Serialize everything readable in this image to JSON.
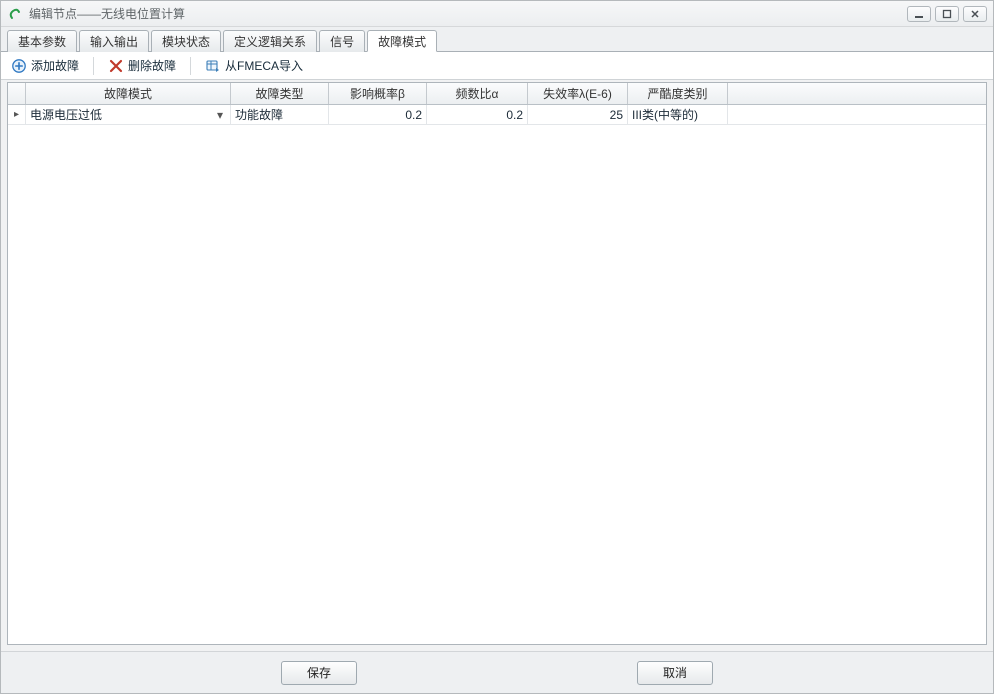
{
  "window": {
    "title": "编辑节点——无线电位置计算"
  },
  "tabs": [
    {
      "label": "基本参数",
      "active": false
    },
    {
      "label": "输入输出",
      "active": false
    },
    {
      "label": "模块状态",
      "active": false
    },
    {
      "label": "定义逻辑关系",
      "active": false
    },
    {
      "label": "信号",
      "active": false
    },
    {
      "label": "故障模式",
      "active": true
    }
  ],
  "toolbar": {
    "add_label": "添加故障",
    "delete_label": "删除故障",
    "import_label": "从FMECA导入"
  },
  "grid": {
    "headers": {
      "mode": "故障模式",
      "type": "故障类型",
      "beta": "影响概率β",
      "alpha": "频数比α",
      "lambda": "失效率λ(E-6)",
      "sev": "严酷度类别"
    },
    "rows": [
      {
        "mode": "电源电压过低",
        "type": "功能故障",
        "beta": "0.2",
        "alpha": "0.2",
        "lambda": "25",
        "sev": "III类(中等的)"
      }
    ]
  },
  "footer": {
    "save_label": "保存",
    "cancel_label": "取消"
  }
}
